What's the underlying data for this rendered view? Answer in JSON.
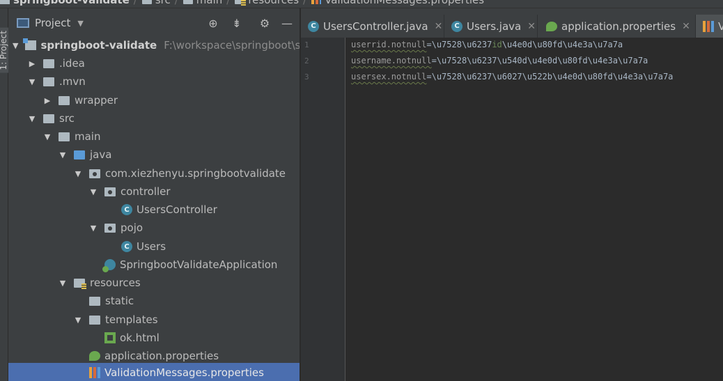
{
  "breadcrumb": [
    "springboot-validate",
    "src",
    "main",
    "resources",
    "ValidationMessages.properties"
  ],
  "tool_stripe": {
    "label": "1: Project"
  },
  "project": {
    "title": "Project",
    "dropdown_icon": "chevron-down-icon",
    "tools": [
      "locate-icon",
      "collapse-all-icon",
      "gear-icon",
      "minimize-icon"
    ],
    "tree": [
      {
        "label": "springboot-validate",
        "path": "F:\\workspace\\springboot\\spr",
        "icon": "module-icon",
        "expanded": true,
        "depth": 0
      },
      {
        "label": ".idea",
        "icon": "folder-icon",
        "expanded": false,
        "depth": 1
      },
      {
        "label": ".mvn",
        "icon": "folder-icon",
        "expanded": true,
        "depth": 1
      },
      {
        "label": "wrapper",
        "icon": "folder-icon",
        "expanded": false,
        "depth": 2
      },
      {
        "label": "src",
        "icon": "folder-icon",
        "expanded": true,
        "depth": 1
      },
      {
        "label": "main",
        "icon": "folder-icon",
        "expanded": true,
        "depth": 2
      },
      {
        "label": "java",
        "icon": "source-folder-icon",
        "expanded": true,
        "depth": 3
      },
      {
        "label": "com.xiezhenyu.springbootvalidate",
        "icon": "package-icon",
        "expanded": true,
        "depth": 4
      },
      {
        "label": "controller",
        "icon": "package-icon",
        "expanded": true,
        "depth": 5
      },
      {
        "label": "UsersController",
        "icon": "class-icon",
        "depth": 6
      },
      {
        "label": "pojo",
        "icon": "package-icon",
        "expanded": true,
        "depth": 5
      },
      {
        "label": "Users",
        "icon": "class-icon",
        "depth": 6
      },
      {
        "label": "SpringbootValidateApplication",
        "icon": "spring-boot-class-icon",
        "depth": 5
      },
      {
        "label": "resources",
        "icon": "resources-folder-icon",
        "expanded": true,
        "depth": 3
      },
      {
        "label": "static",
        "icon": "folder-icon",
        "depth": 4
      },
      {
        "label": "templates",
        "icon": "folder-icon",
        "expanded": true,
        "depth": 4
      },
      {
        "label": "ok.html",
        "icon": "html-file-icon",
        "depth": 5
      },
      {
        "label": "application.properties",
        "icon": "spring-properties-icon",
        "depth": 4
      },
      {
        "label": "ValidationMessages.properties",
        "icon": "properties-file-icon",
        "depth": 4,
        "selected": true
      }
    ]
  },
  "tabs": [
    {
      "label": "UsersController.java",
      "icon": "class-icon"
    },
    {
      "label": "Users.java",
      "icon": "class-icon"
    },
    {
      "label": "application.properties",
      "icon": "spring-properties-icon"
    },
    {
      "label": "V",
      "icon": "properties-file-icon",
      "active": true
    }
  ],
  "editor": {
    "line_numbers": [
      "1",
      "2",
      "3"
    ],
    "lines": [
      {
        "key": "userrid.notnull",
        "eq": "=",
        "value_a": "\\u7528\\u6237",
        "value_hl": "id",
        "value_b": "\\u4e0d\\u80fd\\u4e3a\\u7a7a"
      },
      {
        "key": "username.notnull",
        "eq": "=",
        "value_a": "\\u7528\\u6237\\u540d\\u4e0d\\u80fd\\u4e3a\\u7a7a",
        "value_hl": "",
        "value_b": ""
      },
      {
        "key": "usersex.notnull",
        "eq": "=",
        "value_a": "\\u7528\\u6237\\u6027\\u522b\\u4e0d\\u80fd\\u4e3a\\u7a7a",
        "value_hl": "",
        "value_b": ""
      }
    ]
  },
  "colors": {
    "selection": "#4b6eaf",
    "panel": "#3c3f41",
    "editor": "#2b2b2b"
  }
}
